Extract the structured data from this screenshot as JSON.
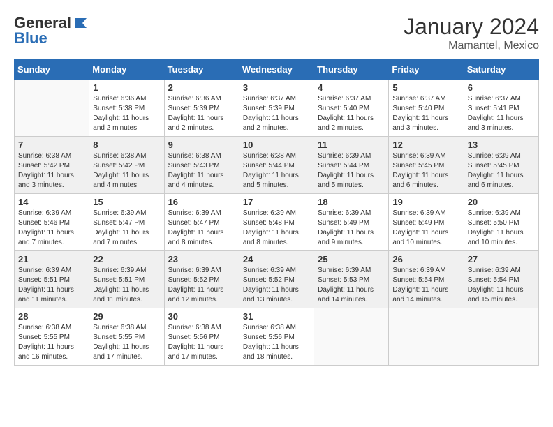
{
  "logo": {
    "general": "General",
    "blue": "Blue"
  },
  "title": "January 2024",
  "location": "Mamantel, Mexico",
  "days": [
    "Sunday",
    "Monday",
    "Tuesday",
    "Wednesday",
    "Thursday",
    "Friday",
    "Saturday"
  ],
  "weeks": [
    [
      {
        "day": "",
        "info": ""
      },
      {
        "day": "1",
        "info": "Sunrise: 6:36 AM\nSunset: 5:38 PM\nDaylight: 11 hours\nand 2 minutes."
      },
      {
        "day": "2",
        "info": "Sunrise: 6:36 AM\nSunset: 5:39 PM\nDaylight: 11 hours\nand 2 minutes."
      },
      {
        "day": "3",
        "info": "Sunrise: 6:37 AM\nSunset: 5:39 PM\nDaylight: 11 hours\nand 2 minutes."
      },
      {
        "day": "4",
        "info": "Sunrise: 6:37 AM\nSunset: 5:40 PM\nDaylight: 11 hours\nand 2 minutes."
      },
      {
        "day": "5",
        "info": "Sunrise: 6:37 AM\nSunset: 5:40 PM\nDaylight: 11 hours\nand 3 minutes."
      },
      {
        "day": "6",
        "info": "Sunrise: 6:37 AM\nSunset: 5:41 PM\nDaylight: 11 hours\nand 3 minutes."
      }
    ],
    [
      {
        "day": "7",
        "info": "Sunrise: 6:38 AM\nSunset: 5:42 PM\nDaylight: 11 hours\nand 3 minutes."
      },
      {
        "day": "8",
        "info": "Sunrise: 6:38 AM\nSunset: 5:42 PM\nDaylight: 11 hours\nand 4 minutes."
      },
      {
        "day": "9",
        "info": "Sunrise: 6:38 AM\nSunset: 5:43 PM\nDaylight: 11 hours\nand 4 minutes."
      },
      {
        "day": "10",
        "info": "Sunrise: 6:38 AM\nSunset: 5:44 PM\nDaylight: 11 hours\nand 5 minutes."
      },
      {
        "day": "11",
        "info": "Sunrise: 6:39 AM\nSunset: 5:44 PM\nDaylight: 11 hours\nand 5 minutes."
      },
      {
        "day": "12",
        "info": "Sunrise: 6:39 AM\nSunset: 5:45 PM\nDaylight: 11 hours\nand 6 minutes."
      },
      {
        "day": "13",
        "info": "Sunrise: 6:39 AM\nSunset: 5:45 PM\nDaylight: 11 hours\nand 6 minutes."
      }
    ],
    [
      {
        "day": "14",
        "info": "Sunrise: 6:39 AM\nSunset: 5:46 PM\nDaylight: 11 hours\nand 7 minutes."
      },
      {
        "day": "15",
        "info": "Sunrise: 6:39 AM\nSunset: 5:47 PM\nDaylight: 11 hours\nand 7 minutes."
      },
      {
        "day": "16",
        "info": "Sunrise: 6:39 AM\nSunset: 5:47 PM\nDaylight: 11 hours\nand 8 minutes."
      },
      {
        "day": "17",
        "info": "Sunrise: 6:39 AM\nSunset: 5:48 PM\nDaylight: 11 hours\nand 8 minutes."
      },
      {
        "day": "18",
        "info": "Sunrise: 6:39 AM\nSunset: 5:49 PM\nDaylight: 11 hours\nand 9 minutes."
      },
      {
        "day": "19",
        "info": "Sunrise: 6:39 AM\nSunset: 5:49 PM\nDaylight: 11 hours\nand 10 minutes."
      },
      {
        "day": "20",
        "info": "Sunrise: 6:39 AM\nSunset: 5:50 PM\nDaylight: 11 hours\nand 10 minutes."
      }
    ],
    [
      {
        "day": "21",
        "info": "Sunrise: 6:39 AM\nSunset: 5:51 PM\nDaylight: 11 hours\nand 11 minutes."
      },
      {
        "day": "22",
        "info": "Sunrise: 6:39 AM\nSunset: 5:51 PM\nDaylight: 11 hours\nand 11 minutes."
      },
      {
        "day": "23",
        "info": "Sunrise: 6:39 AM\nSunset: 5:52 PM\nDaylight: 11 hours\nand 12 minutes."
      },
      {
        "day": "24",
        "info": "Sunrise: 6:39 AM\nSunset: 5:52 PM\nDaylight: 11 hours\nand 13 minutes."
      },
      {
        "day": "25",
        "info": "Sunrise: 6:39 AM\nSunset: 5:53 PM\nDaylight: 11 hours\nand 14 minutes."
      },
      {
        "day": "26",
        "info": "Sunrise: 6:39 AM\nSunset: 5:54 PM\nDaylight: 11 hours\nand 14 minutes."
      },
      {
        "day": "27",
        "info": "Sunrise: 6:39 AM\nSunset: 5:54 PM\nDaylight: 11 hours\nand 15 minutes."
      }
    ],
    [
      {
        "day": "28",
        "info": "Sunrise: 6:38 AM\nSunset: 5:55 PM\nDaylight: 11 hours\nand 16 minutes."
      },
      {
        "day": "29",
        "info": "Sunrise: 6:38 AM\nSunset: 5:55 PM\nDaylight: 11 hours\nand 17 minutes."
      },
      {
        "day": "30",
        "info": "Sunrise: 6:38 AM\nSunset: 5:56 PM\nDaylight: 11 hours\nand 17 minutes."
      },
      {
        "day": "31",
        "info": "Sunrise: 6:38 AM\nSunset: 5:56 PM\nDaylight: 11 hours\nand 18 minutes."
      },
      {
        "day": "",
        "info": ""
      },
      {
        "day": "",
        "info": ""
      },
      {
        "day": "",
        "info": ""
      }
    ]
  ]
}
